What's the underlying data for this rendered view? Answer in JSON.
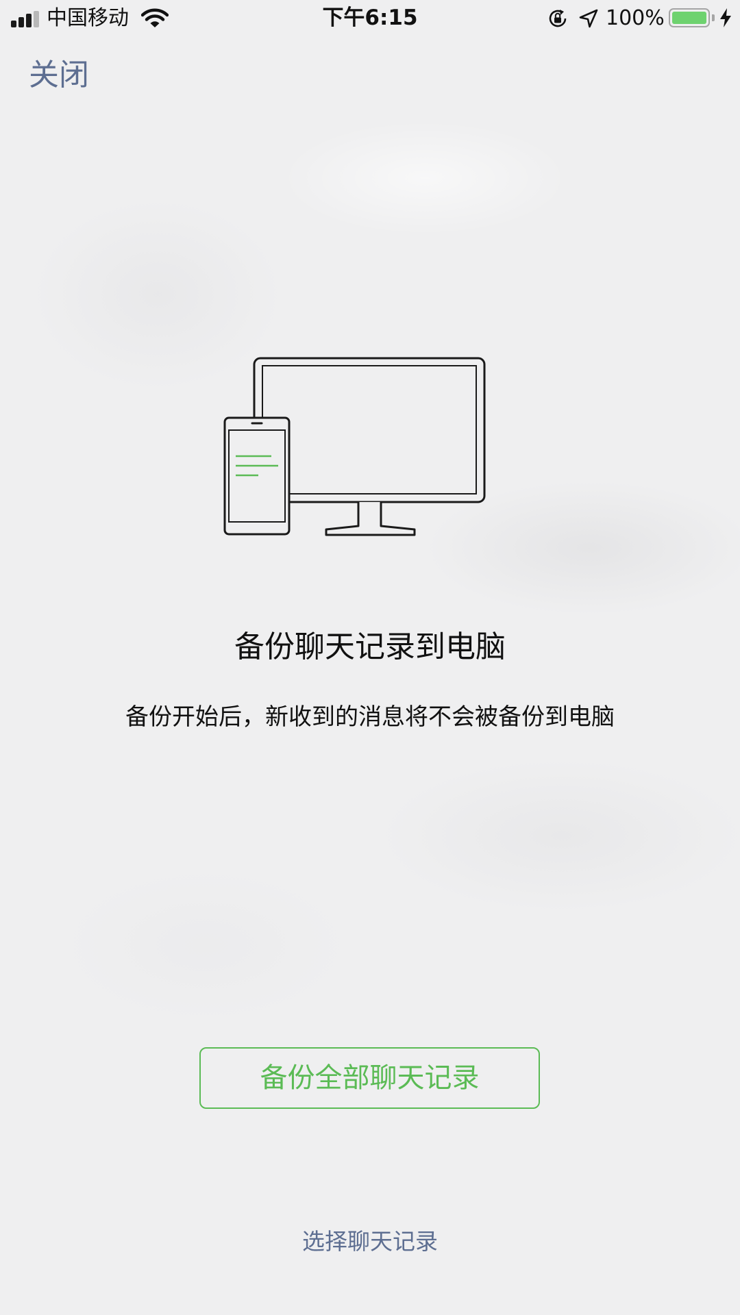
{
  "status_bar": {
    "carrier": "中国移动",
    "time": "下午6:15",
    "battery_percent_text": "100%",
    "battery_level": 1.0,
    "signal_bars_active": 3,
    "signal_bars_total": 4,
    "icons": [
      "signal-icon",
      "wifi-icon",
      "rotation-lock-icon",
      "location-arrow-icon",
      "battery-icon",
      "charging-bolt-icon"
    ]
  },
  "nav": {
    "close_label": "关闭"
  },
  "illustration": {
    "icon": "phone-and-computer-icon",
    "colors": {
      "stroke": "#1a1a1a",
      "accent": "#5bbb55"
    }
  },
  "content": {
    "title": "备份聊天记录到电脑",
    "description": "备份开始后，新收到的消息将不会被备份到电脑"
  },
  "actions": {
    "backup_all_label": "备份全部聊天记录",
    "select_label": "选择聊天记录"
  },
  "colors": {
    "background": "#efeff0",
    "accent_green": "#5bbb55",
    "link_blue": "#5d6e91",
    "battery_green": "#6ed26f"
  }
}
